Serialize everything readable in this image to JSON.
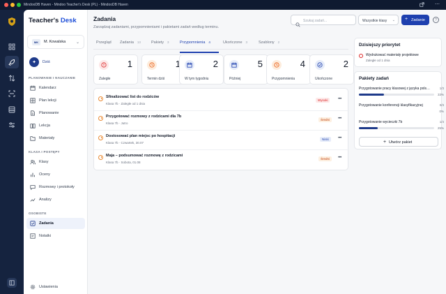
{
  "window": {
    "title": "MindooDB Haven - Mindoo Teacher's Desk (PL) - MindooDB Haven",
    "traffic_colors": [
      "#ff5f57",
      "#febc2e",
      "#28c840"
    ]
  },
  "rail": {
    "icons": [
      "logo-icon",
      "grid-icon",
      "rocket-icon",
      "transfer-icon",
      "scan-icon",
      "database-icon",
      "sliders-icon"
    ],
    "bottom_icon": "panel-toggle-icon"
  },
  "sidebar": {
    "brand_part1": "Teacher's",
    "brand_part2": "Desk",
    "user": {
      "initials": "MK",
      "name": "M. Kowalska"
    },
    "today_label": "Dziś",
    "section_planning": "PLANOWANIE I NAUCZANIE",
    "planning_items": [
      {
        "label": "Kalendarz",
        "icon": "calendar-icon"
      },
      {
        "label": "Plan lekcji",
        "icon": "grid-icon"
      },
      {
        "label": "Planowanie",
        "icon": "document-icon"
      },
      {
        "label": "Lekcja",
        "icon": "book-icon"
      },
      {
        "label": "Materiały",
        "icon": "folder-icon"
      }
    ],
    "section_classes": "KLASA I POSTĘPY",
    "classes_items": [
      {
        "label": "Klasy",
        "icon": "users-icon"
      },
      {
        "label": "Oceny",
        "icon": "chart-icon"
      },
      {
        "label": "Rozmowy i protokoły",
        "icon": "chat-icon"
      },
      {
        "label": "Analizy",
        "icon": "trend-icon"
      }
    ],
    "section_personal": "OSOBISTE",
    "personal_items": [
      {
        "label": "Zadania",
        "icon": "checklist-icon",
        "active": true
      },
      {
        "label": "Notatki",
        "icon": "note-icon"
      }
    ],
    "settings_label": "Ustawienia"
  },
  "header": {
    "title": "Zadania",
    "subtitle": "Zarządzaj zadaniami, przypomnieniami i pakietami zadań według terminu.",
    "search_placeholder": "Szukaj zadań...",
    "class_filter": "Wszystkie klasy",
    "add_button": "Zadanie"
  },
  "tabs": [
    {
      "label": "Przegląd",
      "count": ""
    },
    {
      "label": "Zadania",
      "count": "13"
    },
    {
      "label": "Pakiety",
      "count": "3"
    },
    {
      "label": "Przypomnienia",
      "count": "4",
      "active": true
    },
    {
      "label": "Ukończone",
      "count": "3"
    },
    {
      "label": "Szablony",
      "count": "2"
    }
  ],
  "stats": [
    {
      "label": "Zaległe",
      "value": "1",
      "icon": "alert-icon",
      "color": "#dc2626",
      "bg": "#fde8e8"
    },
    {
      "label": "Termin dziś",
      "value": "1",
      "icon": "clock-icon",
      "color": "#ea580c",
      "bg": "#fdecdc"
    },
    {
      "label": "W tym tygodniu",
      "value": "2",
      "icon": "calendar-icon",
      "color": "#1e40af",
      "bg": "#e6ecf9"
    },
    {
      "label": "Później",
      "value": "5",
      "icon": "calendar-icon",
      "color": "#1e40af",
      "bg": "#e6ecf9"
    },
    {
      "label": "Przypomnienia",
      "value": "4",
      "icon": "clock-icon",
      "color": "#ea580c",
      "bg": "#fdecdc"
    },
    {
      "label": "Ukończone",
      "value": "2",
      "icon": "check-icon",
      "color": "#1e40af",
      "bg": "#e6ecf9"
    }
  ],
  "tasks": [
    {
      "title": "Sfinalizować list do rodziców",
      "meta": "Klasa 7b · Zaległe od 1 dnia",
      "priority": "Wysoki",
      "pcolor": "#dc2626",
      "pbg": "#fde8e8"
    },
    {
      "title": "Przygotować rozmowy z rodzicami dla 7b",
      "meta": "Klasa 7b · Jutro",
      "priority": "Średni",
      "pcolor": "#c2410c",
      "pbg": "#fdf0e1"
    },
    {
      "title": "Dostosować plan miejsc po hospitacji",
      "meta": "Klasa 7b · Czwartek, 30.07",
      "priority": "Niski",
      "pcolor": "#1e40af",
      "pbg": "#e6ecf9"
    },
    {
      "title": "Maja – podsumować rozmowę z rodzicami",
      "meta": "Klasa 7b · Sobota, 01.08",
      "priority": "Średni",
      "pcolor": "#c2410c",
      "pbg": "#fdf0e1"
    }
  ],
  "priority_panel": {
    "title": "Dzisiejszy priorytet",
    "item_title": "Wydrukować materiały projektowe",
    "item_meta": "Zaległe od 1 dnia"
  },
  "packages_panel": {
    "title": "Pakiety zadań",
    "items": [
      {
        "name": "Przygotowanie pracy klasowej z języka polskiego",
        "count": "1/3",
        "progress": 0.33,
        "percent": "33%"
      },
      {
        "name": "Przygotowanie konferencji klasyfikacyjnej",
        "count": "0/3",
        "progress": 0,
        "percent": "0%"
      },
      {
        "name": "Przygotowanie wycieczki 7b",
        "count": "1/4",
        "progress": 0.25,
        "percent": "25%"
      }
    ],
    "create_button": "Utwórz pakiet"
  }
}
